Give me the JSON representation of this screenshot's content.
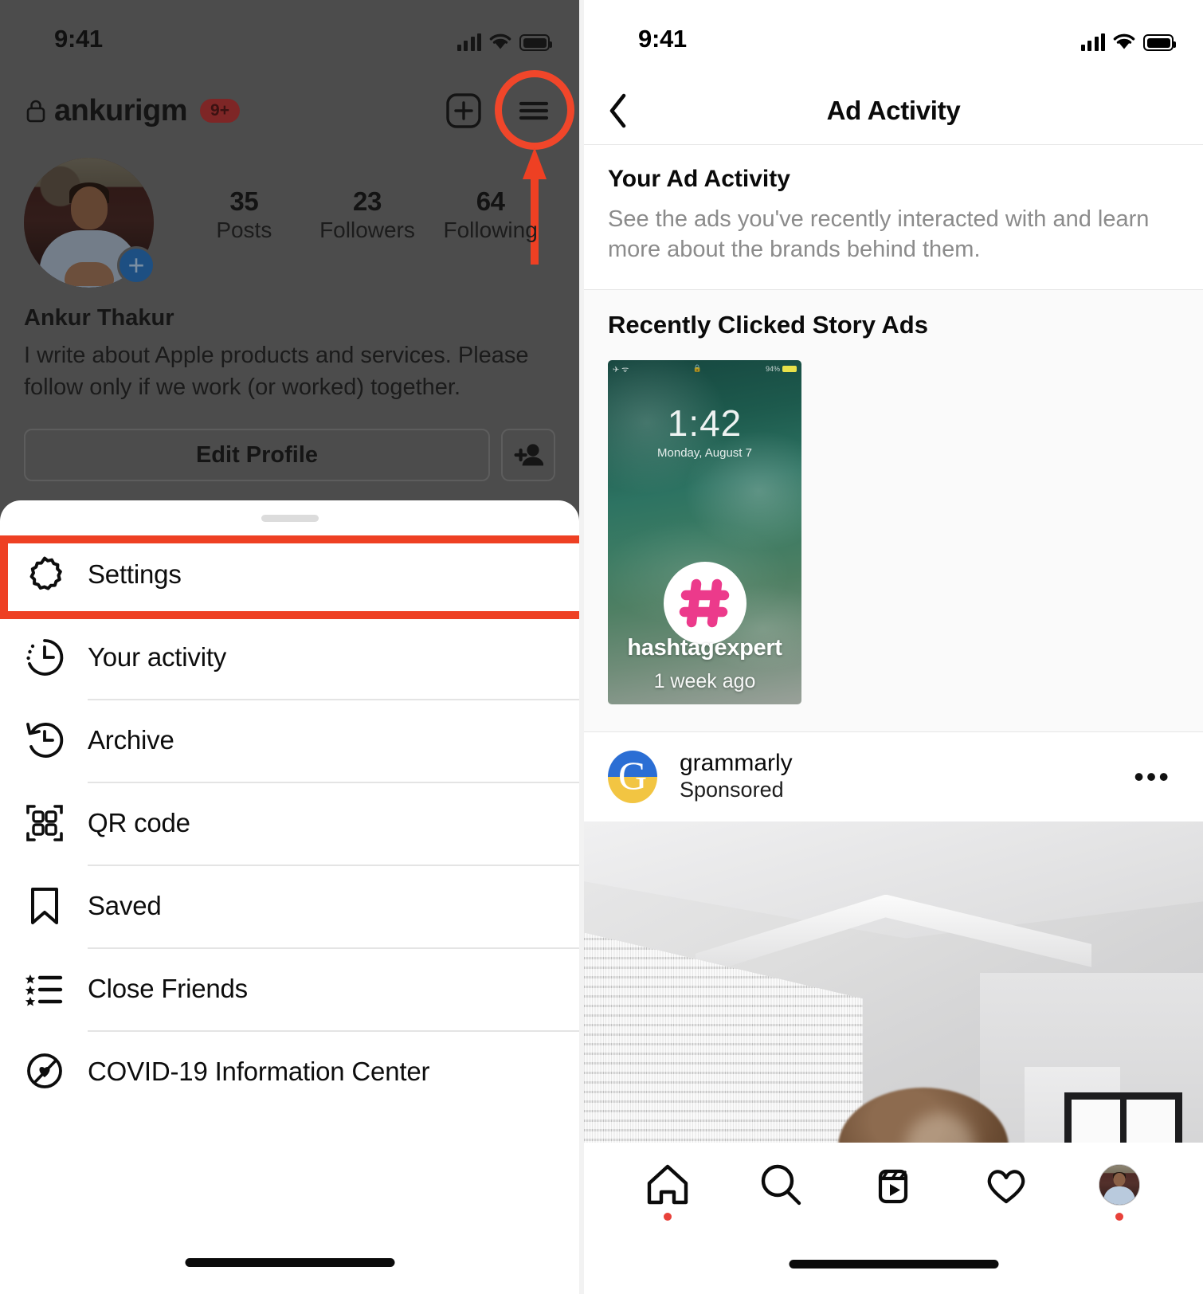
{
  "left_phone": {
    "status_bar": {
      "time": "9:41",
      "icons": [
        "cellular-signal-icon",
        "wifi-icon",
        "battery-icon"
      ]
    },
    "profile_header": {
      "lock_icon": "lock-icon",
      "username": "ankurigm",
      "notification_badge": "9+",
      "add_post_icon": "plus-square-icon",
      "menu_icon": "hamburger-menu-icon"
    },
    "annotations": {
      "highlight_color": "#ee4023",
      "ring_target": "hamburger-menu-icon",
      "arrow_target": "hamburger-menu-icon"
    },
    "profile": {
      "avatar": "profile-avatar",
      "add_story_icon": "plus-circle-icon",
      "stats": [
        {
          "value": "35",
          "label": "Posts"
        },
        {
          "value": "23",
          "label": "Followers"
        },
        {
          "value": "64",
          "label": "Following"
        }
      ],
      "full_name": "Ankur Thakur",
      "bio": "I write about Apple products and services. Please follow only if we work (or worked) together.",
      "edit_profile_label": "Edit Profile",
      "add_person_icon": "person-add-icon"
    },
    "sheet": {
      "items": [
        {
          "label": "Settings",
          "icon": "gear-icon",
          "highlighted": true
        },
        {
          "label": "Your activity",
          "icon": "clock-activity-icon",
          "highlighted": false
        },
        {
          "label": "Archive",
          "icon": "clock-rewind-icon",
          "highlighted": false
        },
        {
          "label": "QR code",
          "icon": "qr-code-icon",
          "highlighted": false
        },
        {
          "label": "Saved",
          "icon": "bookmark-icon",
          "highlighted": false
        },
        {
          "label": "Close Friends",
          "icon": "star-list-icon",
          "highlighted": false
        },
        {
          "label": "COVID-19 Information Center",
          "icon": "covid-info-icon",
          "highlighted": false
        }
      ]
    }
  },
  "right_phone": {
    "status_bar": {
      "time": "9:41",
      "icons": [
        "cellular-signal-icon",
        "wifi-icon",
        "battery-icon"
      ]
    },
    "navbar": {
      "back_icon": "chevron-left-icon",
      "title": "Ad Activity"
    },
    "your_ad_activity": {
      "title": "Your Ad Activity",
      "description": "See the ads you've recently interacted with and learn more about the brands behind them."
    },
    "recently_clicked": {
      "title": "Recently Clicked Story Ads",
      "card": {
        "account": "hashtagexpert",
        "timestamp": "1 week ago",
        "logo_icon": "hashtag-icon",
        "logo_color": "#ec3a8b",
        "wallpaper_time": "1:42",
        "wallpaper_date": "Monday, August 7",
        "wallpaper_battery": "94%"
      }
    },
    "sponsored_post": {
      "account": "grammarly",
      "label": "Sponsored",
      "avatar_icon": "grammarly-logo-icon",
      "avatar_letter": "G",
      "avatar_top_color": "#2b6ed4",
      "avatar_bottom_color": "#f2c542",
      "more_options_icon": "more-options-icon",
      "image": "interior-room-photo"
    },
    "tab_bar": {
      "tabs": [
        {
          "icon": "home-icon",
          "badge_dot": true
        },
        {
          "icon": "search-icon",
          "badge_dot": false
        },
        {
          "icon": "reels-icon",
          "badge_dot": false
        },
        {
          "icon": "heart-icon",
          "badge_dot": false
        },
        {
          "icon": "profile-avatar-icon",
          "badge_dot": true
        }
      ]
    }
  }
}
